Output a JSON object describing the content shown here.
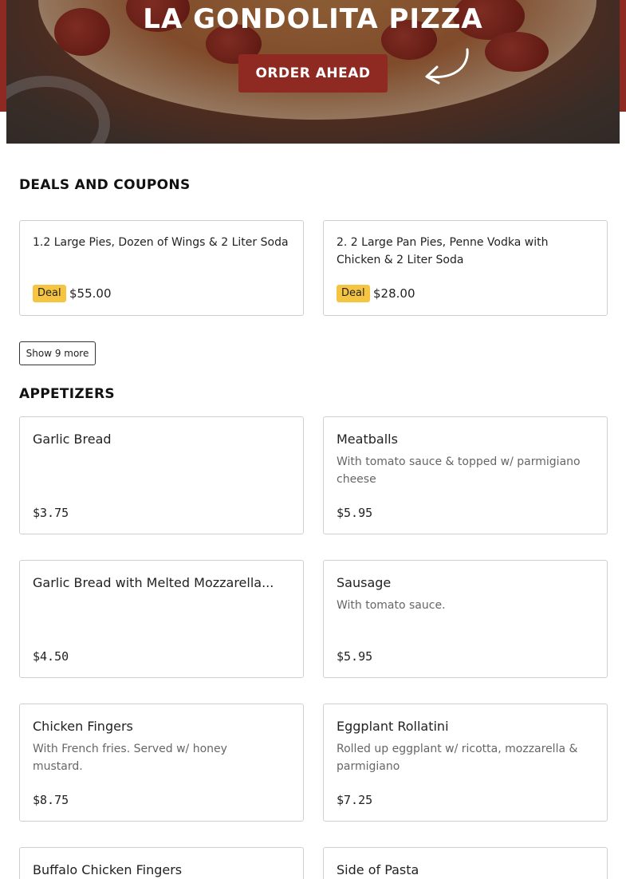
{
  "hero": {
    "title": "LA GONDOLITA PIZZA",
    "order_label": "ORDER AHEAD",
    "accent_color": "#8f2a22"
  },
  "deals": {
    "title": "DEALS AND COUPONS",
    "items": [
      {
        "name": "1.2 Large Pies, Dozen of Wings & 2 Liter Soda",
        "badge": "Deal",
        "price": "$55.00"
      },
      {
        "name": "2. 2 Large Pan Pies, Penne Vodka with Chicken & 2 Liter Soda",
        "badge": "Deal",
        "price": "$28.00"
      }
    ],
    "show_more_label": "Show 9 more",
    "badge_color": "#f5c542"
  },
  "appetizers": {
    "title": "APPETIZERS",
    "items": [
      {
        "name": "Garlic Bread",
        "desc": "",
        "price": "$3.75"
      },
      {
        "name": "Meatballs",
        "desc": "With tomato sauce & topped w/ parmigiano cheese",
        "price": "$5.95"
      },
      {
        "name": "Garlic Bread with Melted Mozzarella...",
        "desc": "",
        "price": "$4.50"
      },
      {
        "name": "Sausage",
        "desc": "With tomato sauce.",
        "price": "$5.95"
      },
      {
        "name": "Chicken Fingers",
        "desc": "With French fries. Served w/ honey mustard.",
        "price": "$8.75"
      },
      {
        "name": "Eggplant Rollatini",
        "desc": "Rolled up eggplant w/ ricotta, mozzarella & parmigiano",
        "price": "$7.25"
      },
      {
        "name": "Buffalo Chicken Fingers",
        "desc": "",
        "price": ""
      },
      {
        "name": "Side of Pasta",
        "desc": "",
        "price": ""
      }
    ]
  },
  "icons": {
    "order_arrow": "curved-arrow-icon"
  }
}
